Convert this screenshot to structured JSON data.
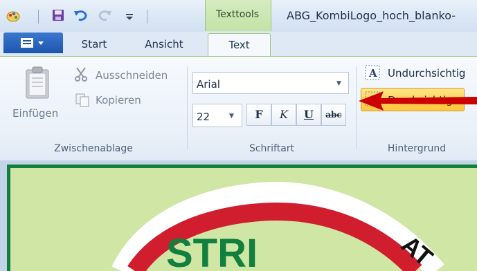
{
  "titlebar": {
    "context_group": "Texttools",
    "document_title": "ABG_KombiLogo_hoch_blanko-"
  },
  "tabs": {
    "start": "Start",
    "ansicht": "Ansicht",
    "text": "Text"
  },
  "clipboard": {
    "paste": "Einfügen",
    "cut": "Ausschneiden",
    "copy": "Kopieren",
    "group_label": "Zwischenablage"
  },
  "font": {
    "family": "Arial",
    "size": "22",
    "bold": "F",
    "italic": "K",
    "underline": "U",
    "strike": "abc",
    "group_label": "Schriftart"
  },
  "background": {
    "opaque": "Undurchsichtig",
    "transparent": "Durchsichtig",
    "group_label": "Hintergrund"
  },
  "logo_text": {
    "arc": "STRI",
    "side": "AT"
  },
  "colors": {
    "ribbon_accent": "#a3c47f",
    "selected_button": "#ffd35a",
    "pointer_arrow": "#cc0000",
    "logo_ring": "#d01e2e",
    "logo_text": "#11803f",
    "canvas_bg": "#cfe6a4"
  }
}
